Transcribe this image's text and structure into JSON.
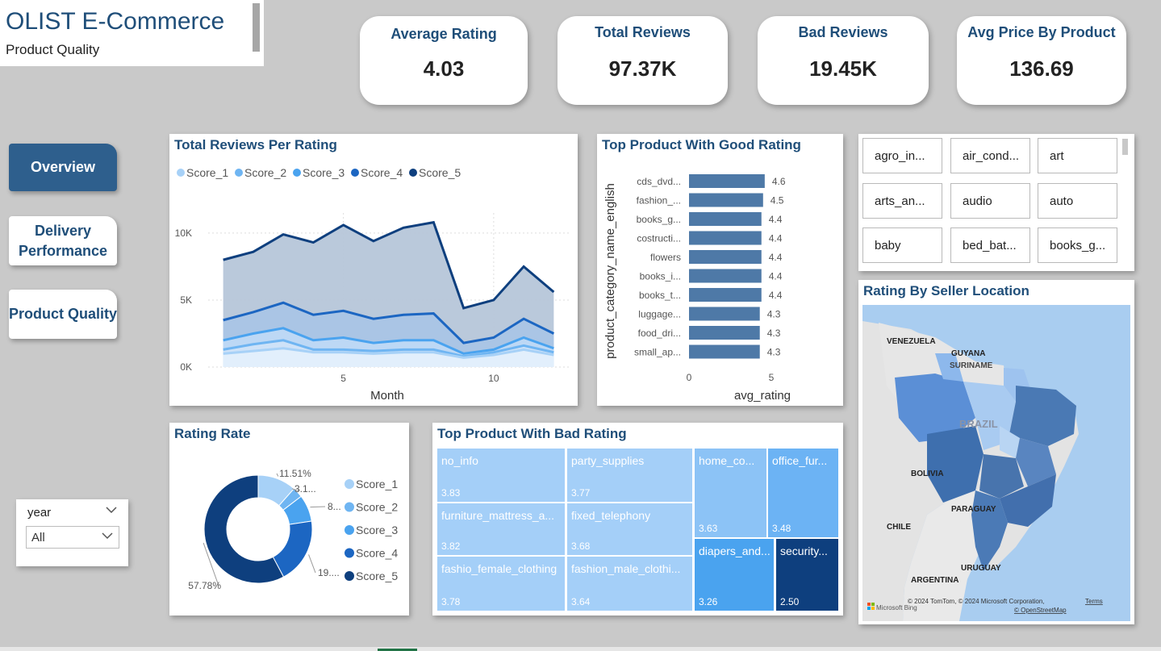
{
  "header": {
    "title": "OLIST E-Commerce",
    "subtitle": "Product Quality"
  },
  "kpis": [
    {
      "label": "Average Rating",
      "value": "4.03"
    },
    {
      "label": "Total Reviews",
      "value": "97.37K"
    },
    {
      "label": "Bad Reviews",
      "value": "19.45K"
    },
    {
      "label": "Avg Price By Product",
      "value": "136.69"
    }
  ],
  "nav": [
    {
      "label": "Overview",
      "active": true
    },
    {
      "label": "Delivery Performance",
      "active": false
    },
    {
      "label": "Product Quality",
      "active": false
    }
  ],
  "year_slicer": {
    "label": "year",
    "value": "All"
  },
  "category_slicer": {
    "items": [
      "agro_in...",
      "air_cond...",
      "art",
      "arts_an...",
      "audio",
      "auto",
      "baby",
      "bed_bat...",
      "books_g..."
    ]
  },
  "colors": {
    "score_1": "#a7d1f7",
    "score_2": "#6fb5f2",
    "score_3": "#4aa3ef",
    "score_4": "#1c66c2",
    "score_5": "#0e3f7e",
    "bar": "#4e79a7",
    "title": "#1f4e79",
    "active_nav": "#2e5f8d"
  },
  "chart_data": [
    {
      "type": "area",
      "title": "Total Reviews Per Rating",
      "xlabel": "Month",
      "ylabel": "",
      "x": [
        1,
        2,
        3,
        4,
        5,
        6,
        7,
        8,
        9,
        10,
        11,
        12
      ],
      "xticks": [
        "5",
        "10"
      ],
      "xtick_values": [
        5,
        10
      ],
      "yticks": [
        "0K",
        "5K",
        "10K"
      ],
      "ytick_values": [
        0,
        5000,
        10000
      ],
      "xlim": [
        0.5,
        12.5
      ],
      "ylim": [
        0,
        11500
      ],
      "series": [
        {
          "name": "Score_1",
          "values": [
            1000,
            1200,
            1400,
            1100,
            1100,
            1000,
            1100,
            1100,
            700,
            900,
            1300,
            900
          ]
        },
        {
          "name": "Score_2",
          "values": [
            1300,
            1700,
            2000,
            1300,
            1300,
            1200,
            1300,
            1300,
            800,
            1100,
            1600,
            1100
          ]
        },
        {
          "name": "Score_3",
          "values": [
            2000,
            2500,
            2900,
            2000,
            2200,
            1800,
            2000,
            2000,
            1000,
            1300,
            2200,
            1400
          ]
        },
        {
          "name": "Score_4",
          "values": [
            3500,
            4100,
            4800,
            3900,
            4200,
            3600,
            3900,
            4000,
            1800,
            2200,
            3600,
            2500
          ]
        },
        {
          "name": "Score_5",
          "values": [
            8000,
            8600,
            9900,
            9300,
            10600,
            9400,
            10400,
            10800,
            4400,
            5000,
            7500,
            5600
          ]
        }
      ]
    },
    {
      "type": "bar",
      "orientation": "horizontal",
      "title": "Top Product With Good Rating",
      "xlabel": "avg_rating",
      "ylabel": "product_category_name_english",
      "categories": [
        "cds_dvd...",
        "fashion_...",
        "books_g...",
        "costructi...",
        "flowers",
        "books_i...",
        "books_t...",
        "luggage...",
        "food_dri...",
        "small_ap..."
      ],
      "values": [
        4.6,
        4.5,
        4.4,
        4.4,
        4.4,
        4.4,
        4.4,
        4.3,
        4.3,
        4.3
      ],
      "data_labels": [
        "4.6",
        "4.5",
        "4.4",
        "4.4",
        "4.4",
        "4.4",
        "4.4",
        "4.3",
        "4.3",
        "4.3"
      ],
      "xticks": [
        "0",
        "5"
      ],
      "xtick_values": [
        0,
        5
      ],
      "xlim": [
        0,
        5
      ]
    },
    {
      "type": "pie",
      "donut": true,
      "title": "Rating Rate",
      "categories": [
        "Score_1",
        "Score_2",
        "Score_3",
        "Score_4",
        "Score_5"
      ],
      "values": [
        11.51,
        3.1,
        8.0,
        19.6,
        57.78
      ],
      "data_labels": [
        "11.51%",
        "3.1...",
        "8...",
        "19....",
        "57.78%"
      ]
    },
    {
      "type": "treemap",
      "title": "Top Product With Bad Rating",
      "categories": [
        "no_info",
        "party_supplies",
        "home_co...",
        "office_fur...",
        "furniture_mattress_a...",
        "fixed_telephony",
        "diapers_and...",
        "security...",
        "fashio_female_clothing",
        "fashion_male_clothi..."
      ],
      "values": [
        3.83,
        3.77,
        3.63,
        3.48,
        3.82,
        3.68,
        3.26,
        2.5,
        3.78,
        3.64
      ],
      "data_labels": [
        "3.83",
        "3.77",
        "3.63",
        "3.48",
        "3.82",
        "3.68",
        "3.26",
        "2.50",
        "3.78",
        "3.64"
      ]
    }
  ],
  "map": {
    "title": "Rating By Seller Location",
    "labels": [
      "VENEZUELA",
      "GUYANA",
      "SURINAME",
      "BRAZIL",
      "BOLIVIA",
      "PARAGUAY",
      "CHILE",
      "URUGUAY",
      "ARGENTINA"
    ],
    "attribution": "© 2024 TomTom, © 2024 Microsoft Corporation,",
    "terms": "Terms",
    "osm": "© OpenStreetMap",
    "logo": "Microsoft Bing"
  }
}
